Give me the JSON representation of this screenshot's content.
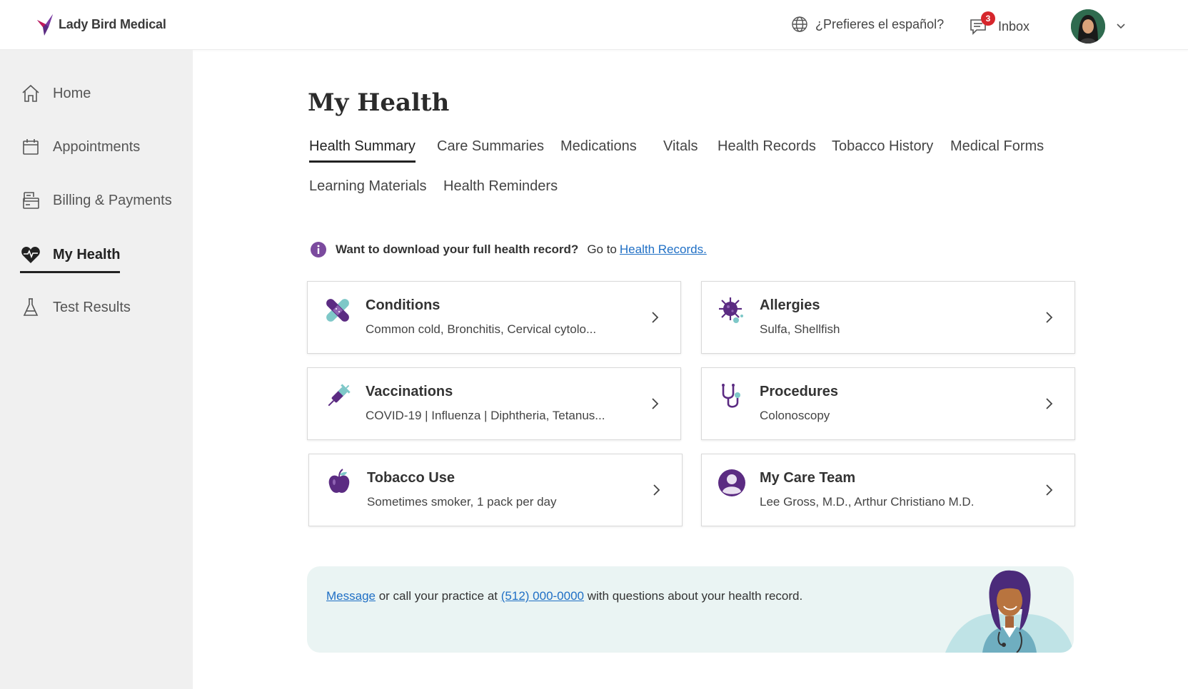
{
  "header": {
    "brand": "Lady Bird Medical",
    "language_prompt": "¿Prefieres el español?",
    "inbox_label": "Inbox",
    "inbox_count": "3"
  },
  "sidebar": {
    "items": [
      {
        "label": "Home",
        "icon": "home-icon"
      },
      {
        "label": "Appointments",
        "icon": "calendar-icon"
      },
      {
        "label": "Billing & Payments",
        "icon": "billing-icon"
      },
      {
        "label": "My Health",
        "icon": "heart-icon",
        "active": true
      },
      {
        "label": "Test Results",
        "icon": "flask-icon"
      }
    ]
  },
  "main": {
    "title": "My Health",
    "tabs": [
      {
        "label": "Health Summary",
        "active": true
      },
      {
        "label": "Care Summaries"
      },
      {
        "label": "Medications"
      },
      {
        "label": "Vitals"
      },
      {
        "label": "Health Records"
      },
      {
        "label": "Tobacco History"
      },
      {
        "label": "Medical Forms"
      },
      {
        "label": "Learning Materials"
      },
      {
        "label": "Health Reminders"
      }
    ],
    "info": {
      "text": "Want to download your full health record?",
      "goto": "Go to",
      "link": "Health Records."
    },
    "cards": [
      {
        "title": "Conditions",
        "subtitle": "Common cold, Bronchitis, Cervical cytolo...",
        "icon": "bandage-icon"
      },
      {
        "title": "Allergies",
        "subtitle": "Sulfa, Shellfish",
        "icon": "virus-icon"
      },
      {
        "title": "Vaccinations",
        "subtitle": "COVID-19 | Influenza | Diphtheria, Tetanus...",
        "icon": "syringe-icon"
      },
      {
        "title": "Procedures",
        "subtitle": "Colonoscopy",
        "icon": "stethoscope-icon"
      },
      {
        "title": "Tobacco Use",
        "subtitle": "Sometimes smoker, 1 pack per day",
        "icon": "apple-icon"
      },
      {
        "title": "My Care Team",
        "subtitle": "Lee Gross, M.D., Arthur Christiano M.D.",
        "icon": "person-icon"
      }
    ],
    "banner": {
      "message_link": "Message",
      "text_1": "or call your practice at",
      "phone": "(512) 000-0000",
      "text_2": "with questions about your health record."
    }
  },
  "colors": {
    "accent_purple": "#5b2b82",
    "teal": "#7ec8c8",
    "link": "#1f6fc5",
    "badge": "#d6262c",
    "sidebar_bg": "#f0f0f0",
    "banner_bg": "#eaf4f3"
  }
}
